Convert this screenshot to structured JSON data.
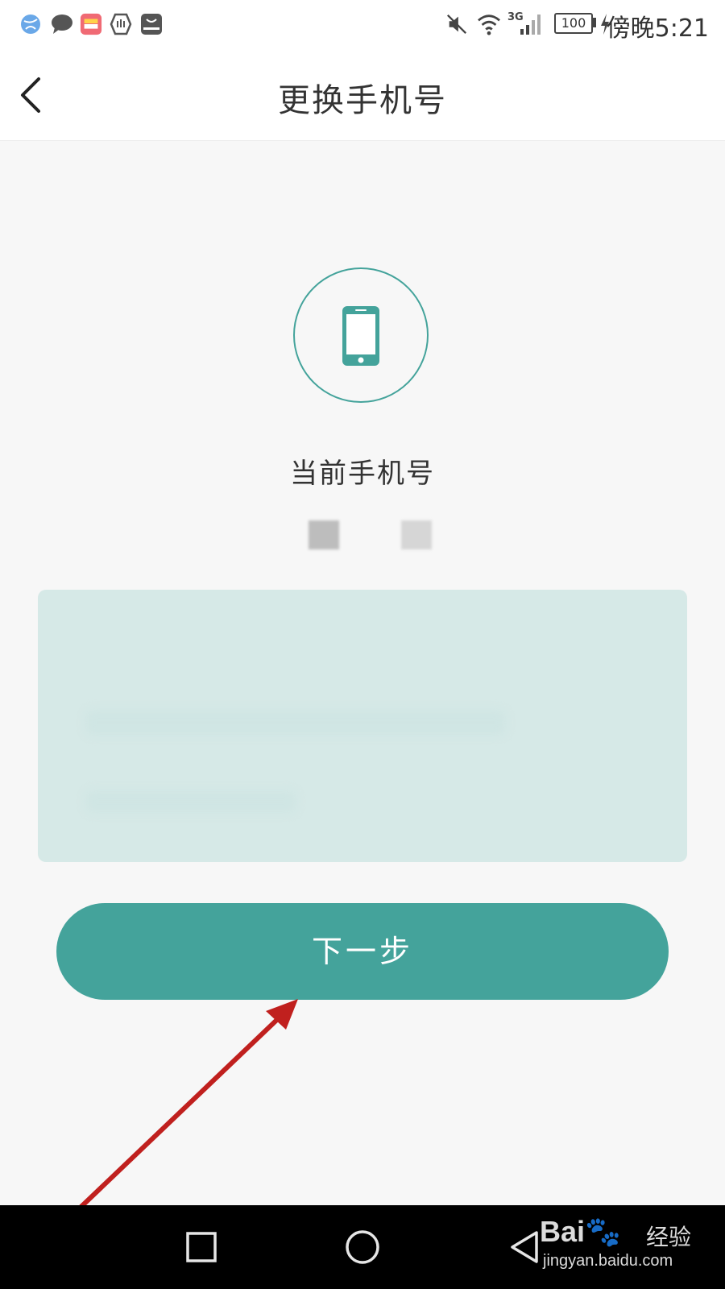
{
  "status_bar": {
    "time": "傍晚5:21",
    "battery": "100",
    "network": "3G",
    "icons": [
      "browser-icon",
      "message-icon",
      "wallet-icon",
      "shield-icon",
      "huawei-store-icon",
      "mute-icon",
      "wifi-icon",
      "signal-icon",
      "battery-icon",
      "charging-icon"
    ]
  },
  "header": {
    "title": "更换手机号",
    "back_icon": "chevron-left-icon"
  },
  "main": {
    "phone_icon": "smartphone-icon",
    "current_label": "当前手机号",
    "next_label": "下一步"
  },
  "nav": {
    "icons": [
      "recent-apps-icon",
      "home-icon",
      "back-icon"
    ]
  },
  "watermark": {
    "brand": "Bai 经验",
    "cn": "经验",
    "url": "jingyan.baidu.com"
  },
  "colors": {
    "accent": "#44a39b",
    "notice_bg": "#d6e9e7",
    "annotation": "#c0201e"
  }
}
